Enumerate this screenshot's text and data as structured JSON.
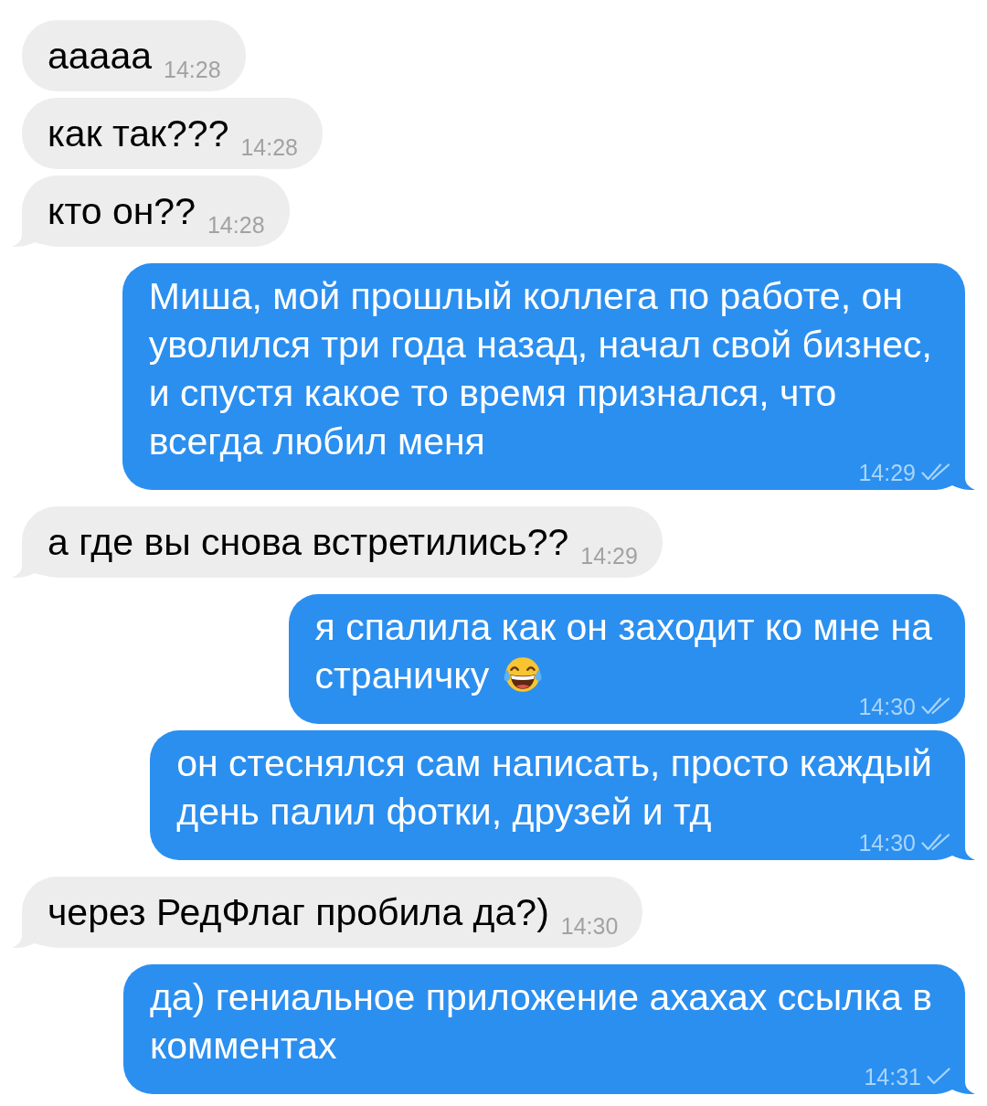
{
  "messages": [
    {
      "kind": "incoming",
      "text": "ааааа",
      "time": "14:28",
      "tail": false
    },
    {
      "kind": "incoming",
      "text": "как так???",
      "time": "14:28",
      "tail": false
    },
    {
      "kind": "incoming",
      "text": "кто он??",
      "time": "14:28",
      "tail": true
    },
    {
      "kind": "outgoing",
      "text": "Миша, мой прошлый коллега по работе, он\nуволился три года назад, начал свой бизнес,\nи спустя какое то время признался, что\nвсегда любил меня",
      "time": "14:29",
      "read": true,
      "tail": true
    },
    {
      "kind": "incoming",
      "text": "а где вы снова встретились??",
      "time": "14:29",
      "tail": true
    },
    {
      "kind": "outgoing",
      "text": "я спалила как он заходит ко мне на\nстраничку",
      "emoji": true,
      "time": "14:30",
      "read": true,
      "tail": false
    },
    {
      "kind": "outgoing",
      "text": "он стеснялся сам написать, просто каждый\nдень палил фотки, друзей и тд",
      "time": "14:30",
      "read": true,
      "tail": true
    },
    {
      "kind": "incoming",
      "text": "через РедФлаг пробила да?)",
      "time": "14:30",
      "tail": true
    },
    {
      "kind": "outgoing",
      "text": "да) гениальное приложение ахахах ссылка в\nкомментах",
      "time": "14:31",
      "read": false,
      "tail": true
    }
  ]
}
